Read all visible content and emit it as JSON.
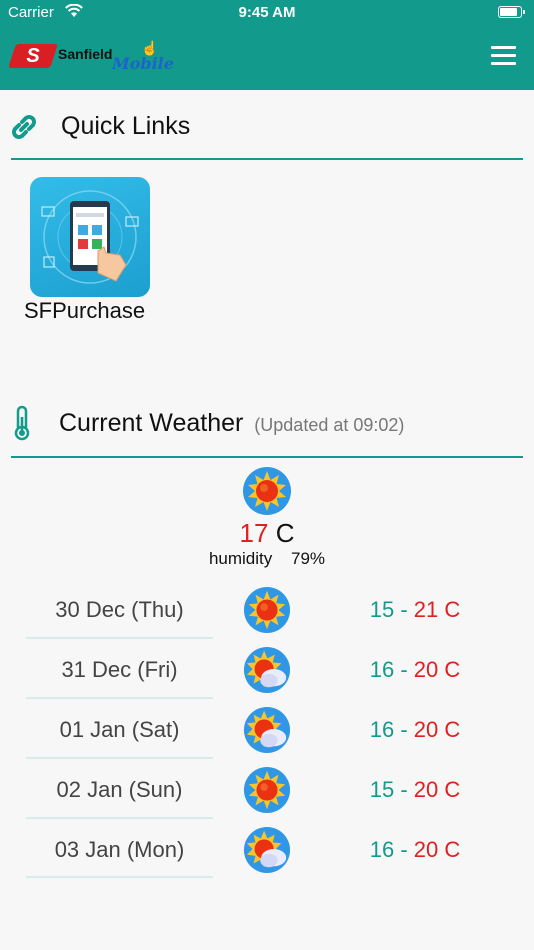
{
  "status_bar": {
    "carrier": "Carrier",
    "time": "9:45 AM",
    "battery_level": 0.9
  },
  "header": {
    "logo": {
      "mark": "S",
      "name": "Sanfield",
      "sub": "Mobile"
    },
    "menu_icon": "hamburger-menu-icon"
  },
  "quick_links": {
    "title": "Quick Links",
    "icon": "link-icon",
    "items": [
      {
        "label": "SFPurchase",
        "icon": "purchase-app-icon"
      }
    ]
  },
  "weather": {
    "title": "Current Weather",
    "updated": "(Updated at 09:02)",
    "icon": "thermometer-icon",
    "current": {
      "temp": "17",
      "unit": "C",
      "humidity_label": "humidity",
      "humidity_value": "79%",
      "condition_icon": "sunny-icon"
    },
    "forecast": [
      {
        "day": "30 Dec (Thu)",
        "low": "15",
        "high": "21 C",
        "icon": "sunny-icon"
      },
      {
        "day": "31 Dec (Fri)",
        "low": "16",
        "high": "20 C",
        "icon": "sun-cloud-icon"
      },
      {
        "day": "01 Jan (Sat)",
        "low": "16",
        "high": "20 C",
        "icon": "sun-cloud-icon"
      },
      {
        "day": "02 Jan (Sun)",
        "low": "15",
        "high": "20 C",
        "icon": "sunny-icon"
      },
      {
        "day": "03 Jan (Mon)",
        "low": "16",
        "high": "20 C",
        "icon": "sun-cloud-icon"
      }
    ]
  },
  "colors": {
    "accent": "#129b8c",
    "temp_high": "#e02020"
  }
}
